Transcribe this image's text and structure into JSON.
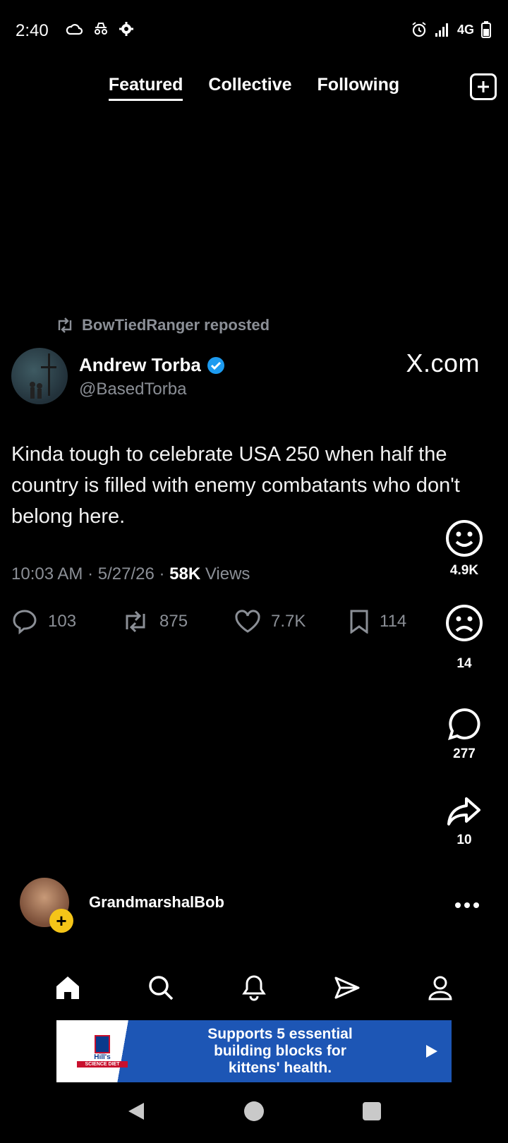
{
  "status_bar": {
    "time": "2:40",
    "network": "4G"
  },
  "tabs": [
    {
      "label": "Featured",
      "active": true
    },
    {
      "label": "Collective",
      "active": false
    },
    {
      "label": "Following",
      "active": false
    }
  ],
  "tweet": {
    "repost_text": "BowTiedRanger reposted",
    "author_name": "Andrew Torba",
    "author_handle": "@BasedTorba",
    "source": "X.com",
    "text": "Kinda tough to celebrate USA 250 when half the country is filled with enemy combatants who don't belong here.",
    "time": "10:03 AM",
    "date": "5/27/26",
    "views_count": "58K",
    "views_label": "Views",
    "replies": "103",
    "reposts": "875",
    "likes": "7.7K",
    "bookmarks": "114"
  },
  "reactions": {
    "happy": "4.9K",
    "sad": "14",
    "comments": "277",
    "shares": "10"
  },
  "creator": {
    "name": "GrandmarshalBob"
  },
  "ad": {
    "brand": "Hill's",
    "brand_sub": "SCIENCE DIET",
    "text_line1": "Supports 5 essential",
    "text_line2": "building blocks for",
    "text_line3": "kittens' health."
  },
  "colors": {
    "verified": "#1d9bf0",
    "follow_plus": "#f5c518",
    "ad_bg": "#1d56b5"
  }
}
